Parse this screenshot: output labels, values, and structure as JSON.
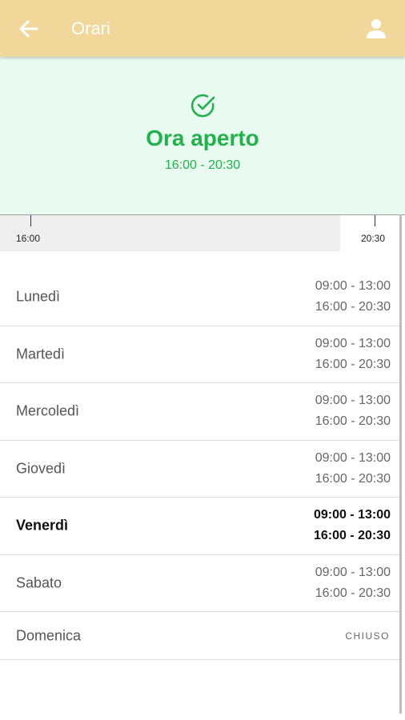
{
  "header": {
    "title": "Orari",
    "back_icon": "arrow-left-icon",
    "user_icon": "person-icon",
    "background": "#f2d79a"
  },
  "status": {
    "icon": "check-circle-icon",
    "headline": "Ora aperto",
    "range": "16:00 - 20:30",
    "accent": "#22b24c",
    "background": "#e9fbf1"
  },
  "timeline": {
    "start_label": "16:00",
    "end_label": "20:30",
    "elapsed_fraction": 0.9
  },
  "days": [
    {
      "name": "Lunedì",
      "slot1": "09:00 - 13:00",
      "slot2": "16:00 - 20:30"
    },
    {
      "name": "Martedì",
      "slot1": "09:00 - 13:00",
      "slot2": "16:00 - 20:30"
    },
    {
      "name": "Mercoledì",
      "slot1": "09:00 - 13:00",
      "slot2": "16:00 - 20:30"
    },
    {
      "name": "Giovedì",
      "slot1": "09:00 - 13:00",
      "slot2": "16:00 - 20:30"
    },
    {
      "name": "Venerdì",
      "slot1": "09:00 - 13:00",
      "slot2": "16:00 - 20:30",
      "today": true
    },
    {
      "name": "Sabato",
      "slot1": "09:00 - 13:00",
      "slot2": "16:00 - 20:30"
    },
    {
      "name": "Domenica",
      "closed": "CHIUSO"
    }
  ]
}
